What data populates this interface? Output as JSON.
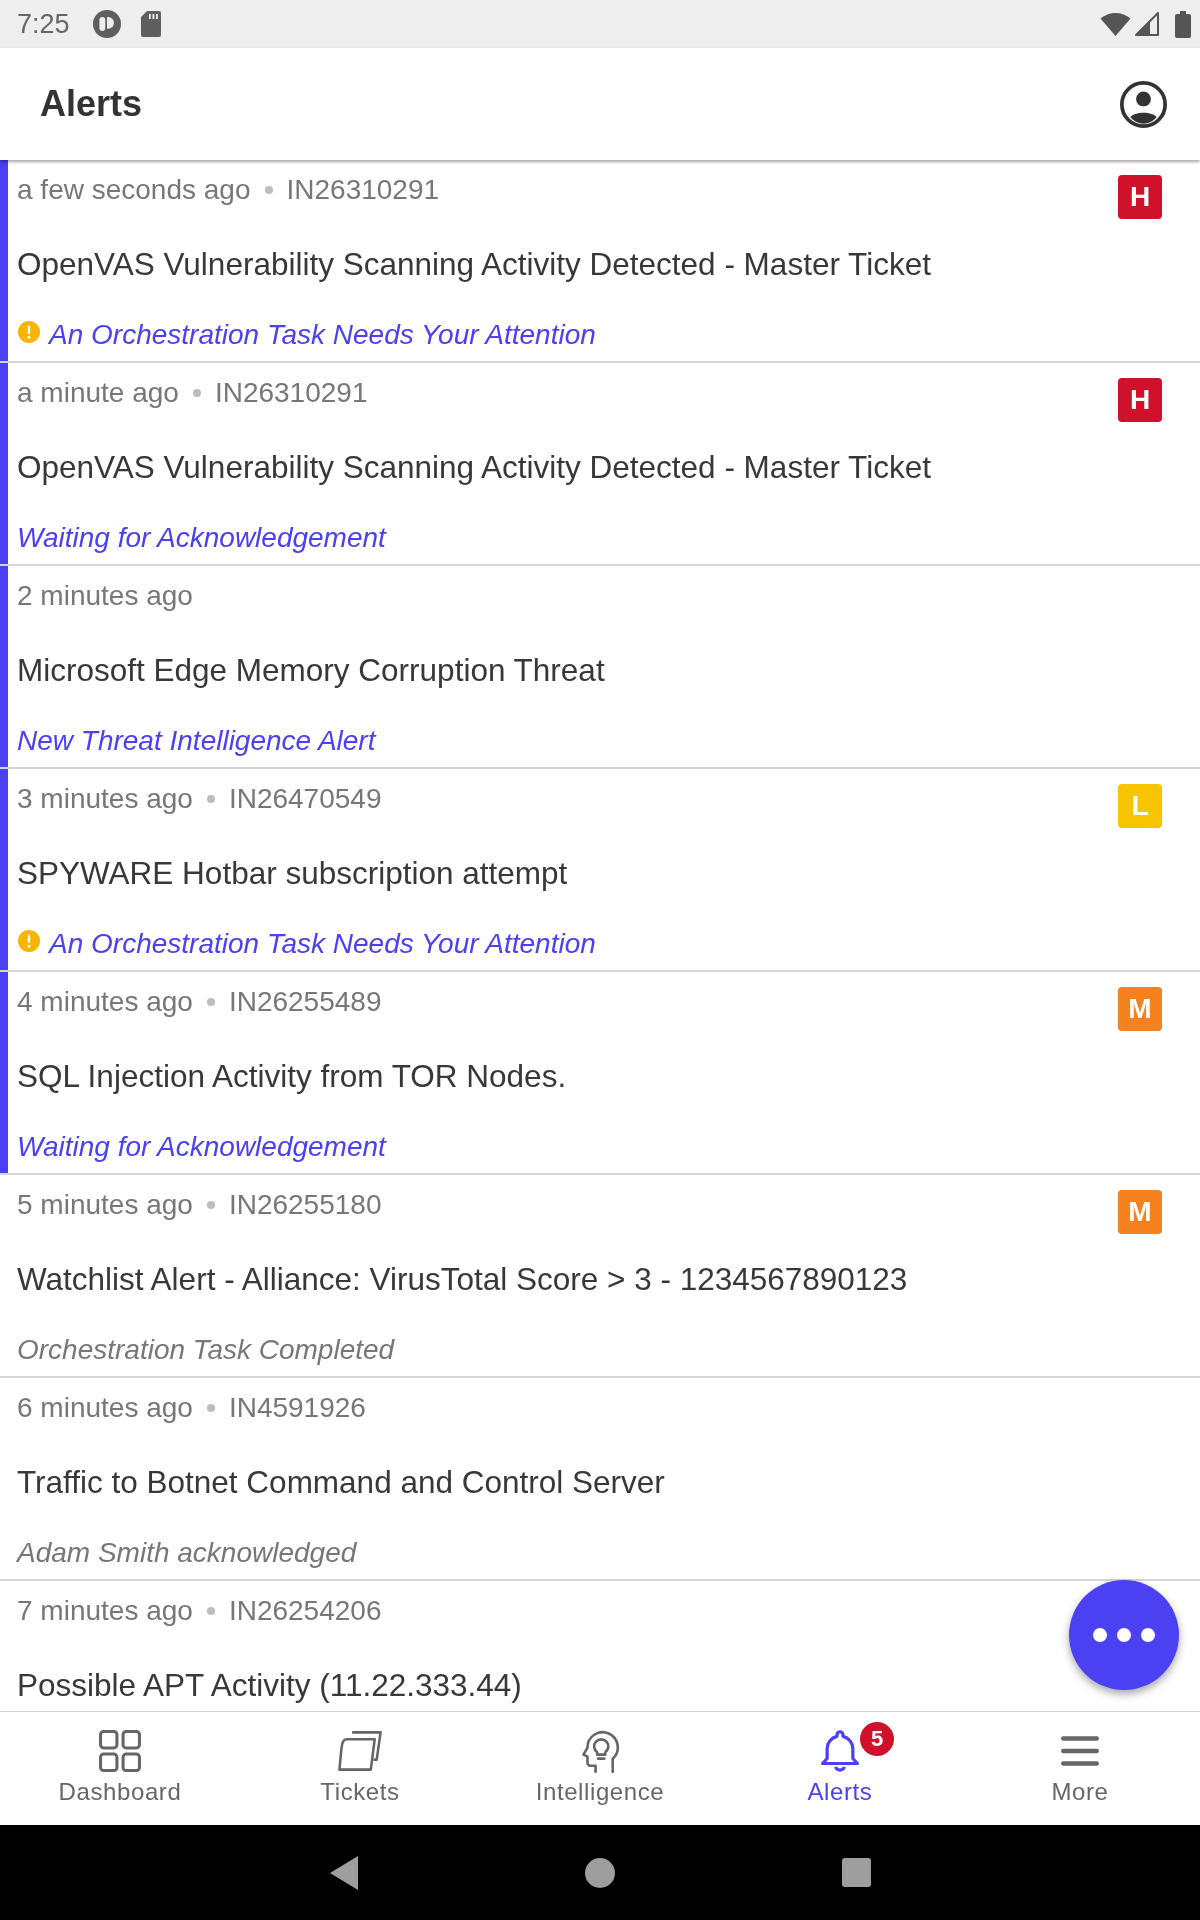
{
  "status_bar": {
    "time": "7:25"
  },
  "app_bar": {
    "title": "Alerts"
  },
  "alerts": [
    {
      "time": "a few seconds ago",
      "ticket_id": "IN26310291",
      "title": "OpenVAS Vulnerability Scanning Activity Detected - Master Ticket",
      "status": "An Orchestration Task Needs Your Attention",
      "needs_attention": true,
      "resolved": false,
      "unread": true,
      "severity": {
        "label": "H",
        "color": "#d0112b"
      }
    },
    {
      "time": "a minute ago",
      "ticket_id": "IN26310291",
      "title": "OpenVAS Vulnerability Scanning Activity Detected - Master Ticket",
      "status": "Waiting for Acknowledgement",
      "needs_attention": false,
      "resolved": false,
      "unread": true,
      "severity": {
        "label": "H",
        "color": "#d0112b"
      }
    },
    {
      "time": "2 minutes ago",
      "title": "Microsoft Edge Memory Corruption Threat",
      "status": "New Threat Intelligence Alert",
      "needs_attention": false,
      "resolved": false,
      "unread": true
    },
    {
      "time": "3 minutes ago",
      "ticket_id": "IN26470549",
      "title": "SPYWARE Hotbar subscription attempt",
      "status": "An Orchestration Task Needs Your Attention",
      "needs_attention": true,
      "resolved": false,
      "unread": true,
      "severity": {
        "label": "L",
        "color": "#f6c500"
      }
    },
    {
      "time": "4 minutes ago",
      "ticket_id": "IN26255489",
      "title": "SQL Injection Activity from TOR Nodes.",
      "status": "Waiting for Acknowledgement",
      "needs_attention": false,
      "resolved": false,
      "unread": true,
      "severity": {
        "label": "M",
        "color": "#f5821f"
      }
    },
    {
      "time": "5 minutes ago",
      "ticket_id": "IN26255180",
      "title": "Watchlist Alert - Alliance: VirusTotal Score > 3 - 1234567890123",
      "status": "Orchestration Task Completed",
      "needs_attention": false,
      "resolved": true,
      "unread": false,
      "severity": {
        "label": "M",
        "color": "#f5821f"
      }
    },
    {
      "time": "6 minutes ago",
      "ticket_id": "IN4591926",
      "title": "Traffic to Botnet Command and Control Server",
      "status": "Adam Smith acknowledged",
      "needs_attention": false,
      "resolved": true,
      "unread": false
    },
    {
      "time": "7 minutes ago",
      "ticket_id": "IN26254206",
      "title": "Possible APT Activity (11.22.333.44)",
      "unread": false
    }
  ],
  "bottom_nav": {
    "items": [
      {
        "label": "Dashboard",
        "selected": false
      },
      {
        "label": "Tickets",
        "selected": false
      },
      {
        "label": "Intelligence",
        "selected": false
      },
      {
        "label": "Alerts",
        "selected": true,
        "badge": "5"
      },
      {
        "label": "More",
        "selected": false
      }
    ]
  }
}
